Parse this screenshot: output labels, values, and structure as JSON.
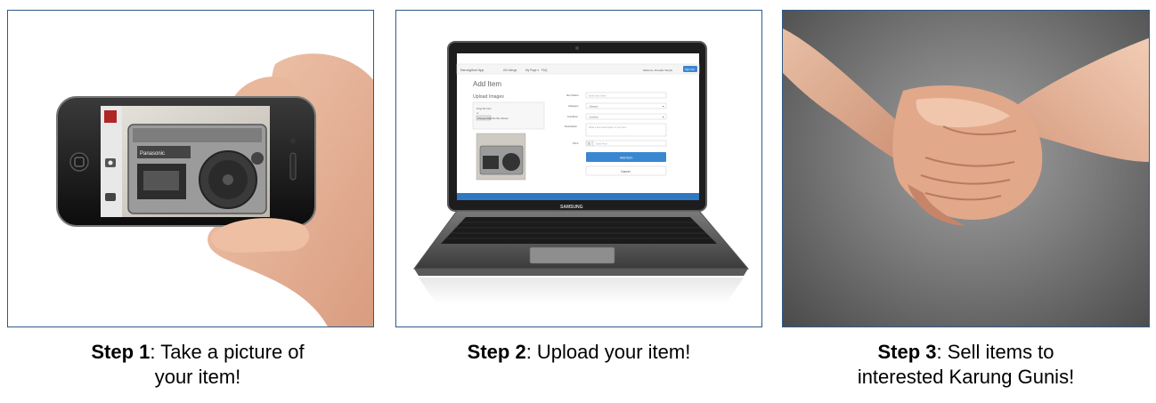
{
  "steps": [
    {
      "label": "Step 1",
      "text_line1": ": Take a picture of",
      "text_line2": "your item!"
    },
    {
      "label": "Step 2",
      "text_line1": ": Upload your item!"
    },
    {
      "label": "Step 3",
      "text_line1": ": Sell items to",
      "text_line2": "interested Karung Gunis!"
    }
  ],
  "phone": {
    "boombox_brand": "Panasonic"
  },
  "laptop": {
    "brand": "SAMSUNG",
    "app": {
      "nav_brand": "KarungGuni App",
      "nav_links": [
        "All Listings",
        "My Page ▾",
        "FAQ"
      ],
      "nav_welcome": "Welcome, Ronaldo Tan(uf)",
      "nav_button": "Sign Out",
      "page_title": "Add Item",
      "upload_title": "Upload Images",
      "drag_label": "Drag file here",
      "or_label": "or",
      "choose_file_button": "Choose Files",
      "no_file_label": "No file chosen",
      "field_labels": [
        "Item Name",
        "Category",
        "Condition",
        "Description",
        "Price"
      ],
      "field_values": [
        "Enter Item Name",
        "Category",
        "Condition",
        "Write a short description of your item",
        "Enter Price"
      ],
      "price_prefix": "$",
      "add_button": "Add Item",
      "cancel_button": "Cancel"
    }
  },
  "colors": {
    "panel_border": "#2e5a88",
    "app_primary": "#3a87d1",
    "app_navbar": "#f7f7f7"
  }
}
